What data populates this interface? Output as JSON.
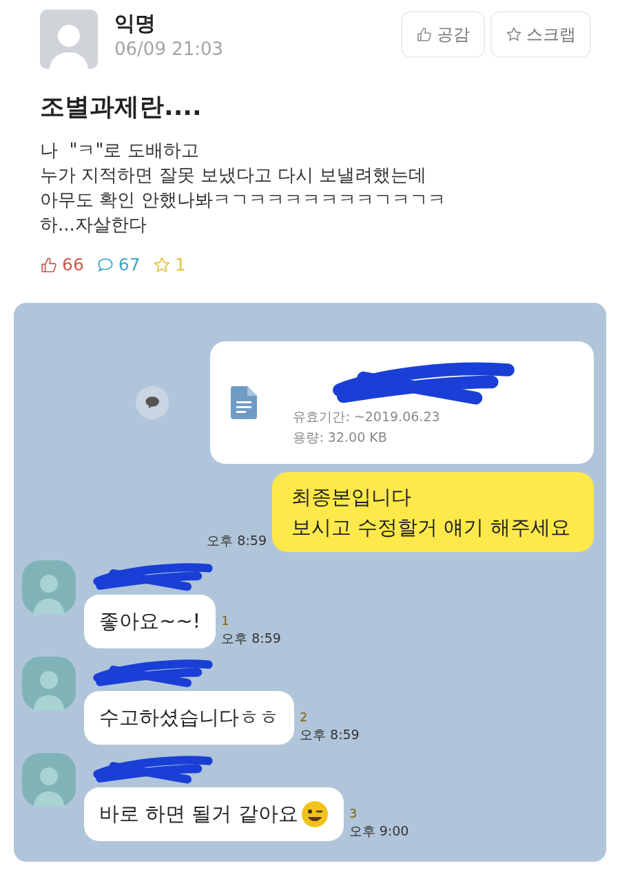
{
  "post": {
    "author": "익명",
    "datetime": "06/09 21:03",
    "actions": [
      {
        "kind": "like",
        "label": "공감"
      },
      {
        "kind": "scrap",
        "label": "스크랩"
      }
    ],
    "title": "조별과제란....",
    "body": [
      "나  \"ㅋ\"로 도배하고",
      "누가 지적하면 잘못 보냈다고 다시 보낼려했는데",
      "아무도 확인 안했나봐ㅋㄱㅋㅋㅋㅋㅋㅋㅋㄱㅋㄱㅋ",
      "하...자살한다"
    ],
    "stats": [
      {
        "kind": "like",
        "count": "66",
        "color": "#c9584a"
      },
      {
        "kind": "comment",
        "count": "67",
        "color": "#3ea6c6"
      },
      {
        "kind": "scrap",
        "count": "1",
        "color": "#e2c23a"
      }
    ]
  },
  "chat": {
    "messages": [
      {
        "kind": "file",
        "expiry": "유효기간: ~2019.06.23",
        "size": "용량: 32.00 KB"
      },
      {
        "kind": "sent",
        "lines": [
          "최종본입니다",
          "보시고 수정할거 얘기 해주세요"
        ],
        "time": "오후 8:59"
      },
      {
        "kind": "received",
        "text": "좋아요~~!",
        "unread": "1",
        "time": "오후 8:59",
        "emoji": false
      },
      {
        "kind": "received",
        "text": "수고하셨습니다ㅎㅎ",
        "unread": "2",
        "time": "오후 8:59",
        "emoji": false
      },
      {
        "kind": "received",
        "text": "바로 하면 될거 같아요",
        "unread": "3",
        "time": "오후 9:00",
        "emoji": true
      }
    ]
  }
}
